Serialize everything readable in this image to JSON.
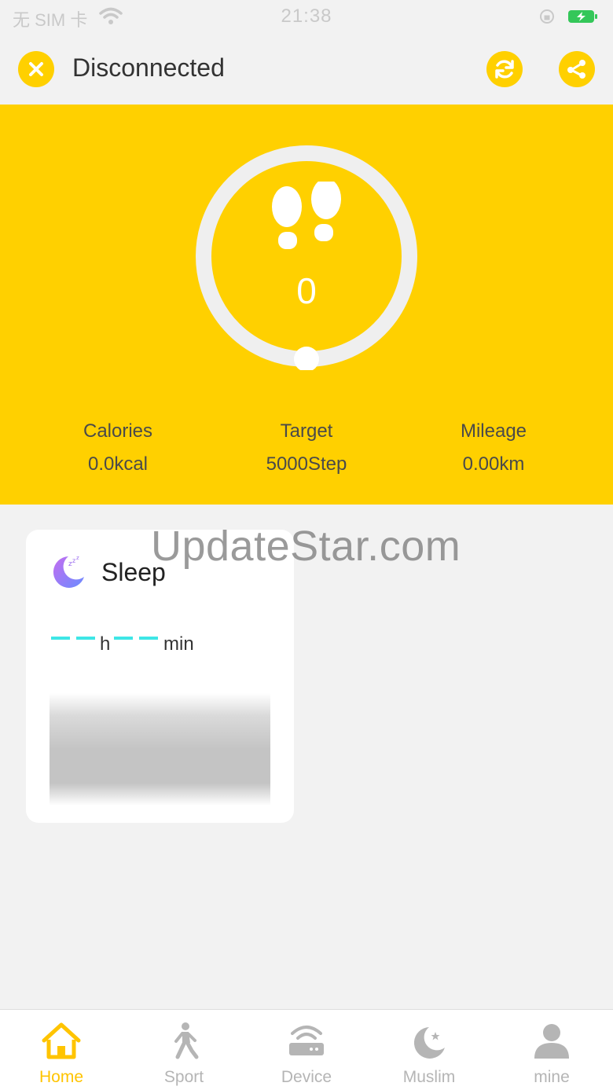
{
  "status_bar": {
    "carrier": "无 SIM 卡",
    "time": "21:38"
  },
  "header": {
    "title": "Disconnected",
    "close_icon": "close-icon",
    "sync_icon": "sync-icon",
    "share_icon": "share-icon"
  },
  "steps_panel": {
    "step_count": "0",
    "stats": [
      {
        "label": "Calories",
        "value": "0.0kcal"
      },
      {
        "label": "Target",
        "value": "5000Step"
      },
      {
        "label": "Mileage",
        "value": "0.00km"
      }
    ]
  },
  "sleep_card": {
    "title": "Sleep",
    "hours_unit": "h",
    "minutes_unit": "min"
  },
  "watermark": "UpdateStar.com",
  "tabs": [
    {
      "label": "Home",
      "icon": "home-icon",
      "active": true
    },
    {
      "label": "Sport",
      "icon": "running-person-icon",
      "active": false
    },
    {
      "label": "Device",
      "icon": "router-device-icon",
      "active": false
    },
    {
      "label": "Muslim",
      "icon": "crescent-star-icon",
      "active": false
    },
    {
      "label": "mine",
      "icon": "user-icon",
      "active": false
    }
  ],
  "colors": {
    "accent": "#ffd000",
    "active_tab": "#ffc400",
    "inactive_tab": "#b5b5b5",
    "sleep_dash": "#3ee6e6"
  }
}
